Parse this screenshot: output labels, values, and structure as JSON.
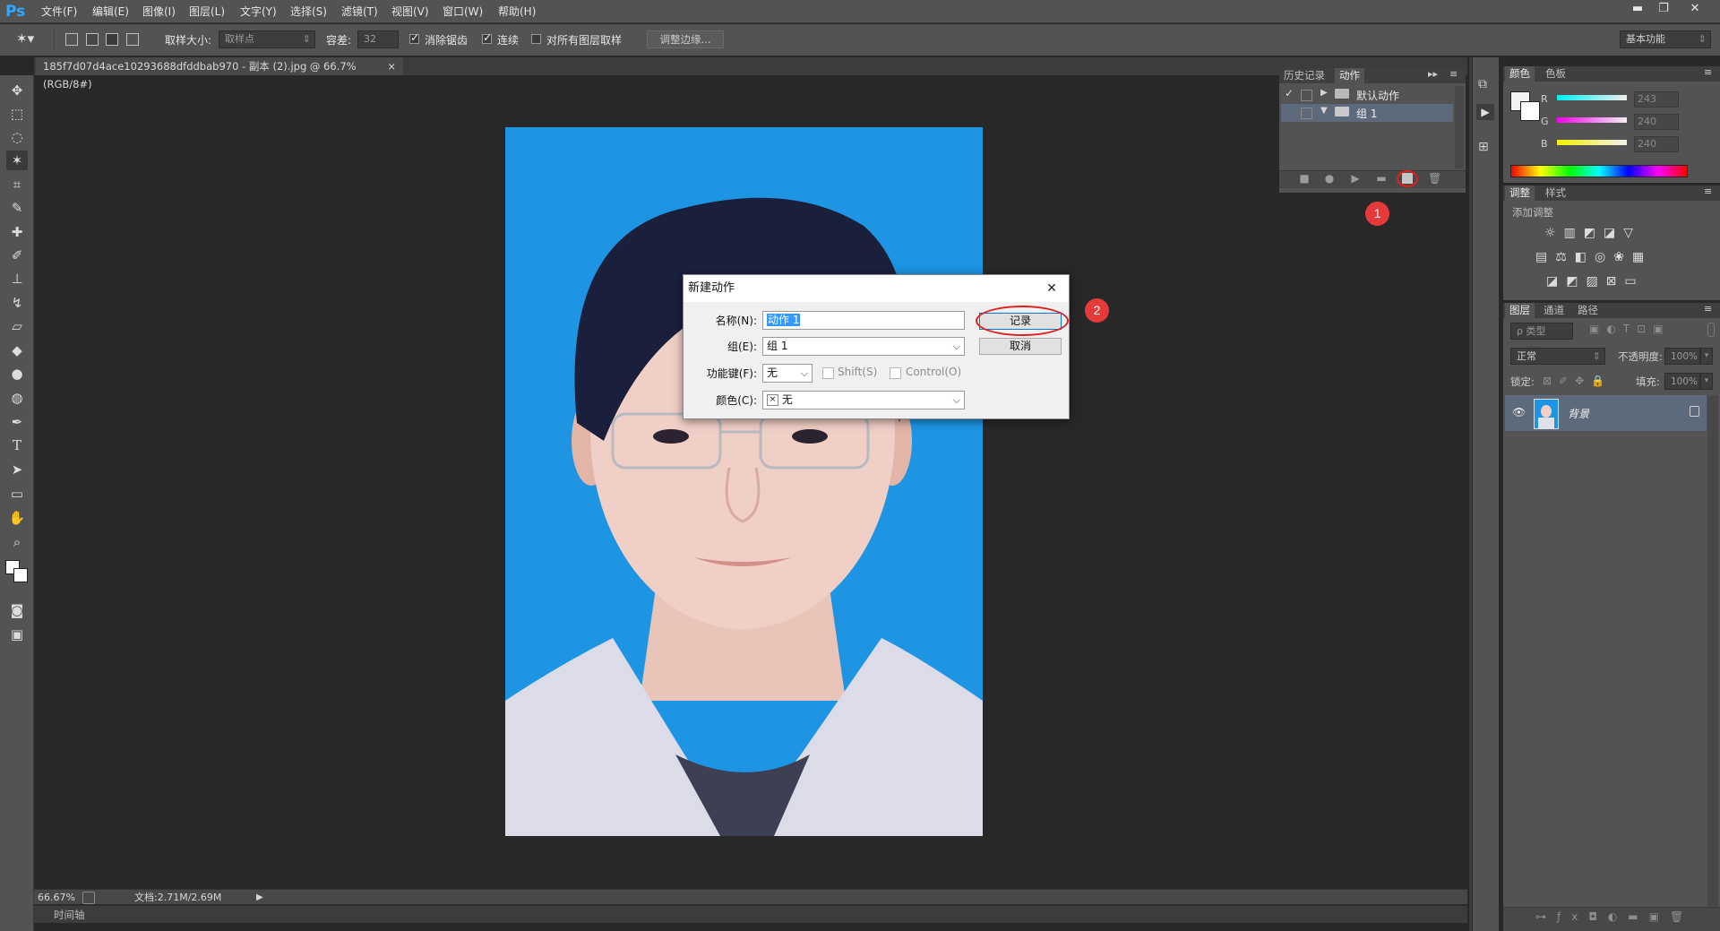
{
  "app": {
    "logo": "Ps",
    "workspace": "基本功能"
  },
  "menu": [
    "文件(F)",
    "编辑(E)",
    "图像(I)",
    "图层(L)",
    "文字(Y)",
    "选择(S)",
    "滤镜(T)",
    "视图(V)",
    "窗口(W)",
    "帮助(H)"
  ],
  "options": {
    "sample_size_label": "取样大小:",
    "sample_size_value": "取样点",
    "tolerance_label": "容差:",
    "tolerance_value": "32",
    "anti_alias": "消除锯齿",
    "contiguous": "连续",
    "sample_all_layers": "对所有图层取样",
    "refine_edge": "调整边缘..."
  },
  "document": {
    "tab_title": "185f7d07d4ace10293688dfddbab970 - 副本 (2).jpg @ 66.7%(RGB/8#)",
    "close": "×",
    "zoom": "66.67%",
    "doc_size": "文档:2.71M/2.69M"
  },
  "timeline": "时间轴",
  "actions_panel": {
    "tabs": [
      "历史记录",
      "动作"
    ],
    "items": [
      {
        "name": "默认动作",
        "checked": true,
        "expanded": false
      },
      {
        "name": "组 1",
        "checked": false,
        "expanded": true
      }
    ]
  },
  "color_panel": {
    "tabs": [
      "颜色",
      "色板"
    ],
    "channels": [
      {
        "label": "R",
        "value": "243"
      },
      {
        "label": "G",
        "value": "240"
      },
      {
        "label": "B",
        "value": "240"
      }
    ]
  },
  "adjust_panel": {
    "tabs": [
      "调整",
      "样式"
    ],
    "add_label": "添加调整"
  },
  "layers_panel": {
    "tabs": [
      "图层",
      "通道",
      "路径"
    ],
    "kind": "ρ 类型",
    "blend_mode": "正常",
    "opacity_label": "不透明度:",
    "opacity_value": "100%",
    "lock_label": "锁定:",
    "fill_label": "填充:",
    "fill_value": "100%",
    "layer_name": "背景"
  },
  "dialog": {
    "title": "新建动作",
    "close": "✕",
    "name_label": "名称(N):",
    "name_value": "动作 1",
    "group_label": "组(E):",
    "group_value": "组 1",
    "fkey_label": "功能键(F):",
    "fkey_value": "无",
    "shift_label": "Shift(S)",
    "control_label": "Control(O)",
    "color_label": "颜色(C):",
    "color_value": "无",
    "color_x": "×",
    "record_button": "记录",
    "cancel_button": "取消"
  },
  "markers": [
    "1",
    "2"
  ],
  "colors": {
    "photo_bg": "#1e95e3",
    "marker": "#e53a3a",
    "ring": "#e02020",
    "selection": "#3399ff"
  }
}
